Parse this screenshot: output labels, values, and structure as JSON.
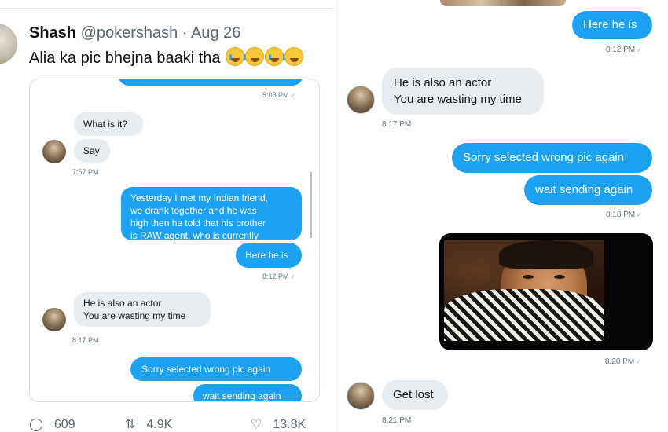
{
  "tweet": {
    "name": "Shash",
    "handle": "@pokershash",
    "dot": "·",
    "date": "Aug 26",
    "text": "Alia ka pic bhejna baaki tha",
    "emojis": [
      "loudly-crying-face",
      "grinning-squinting-face",
      "loudly-crying-face",
      "grinning-squinting-face"
    ],
    "actions": {
      "replies": "609",
      "retweets": "4.9K",
      "likes": "13.8K"
    }
  },
  "embedded_chat": {
    "messages": [
      {
        "side": "out",
        "time": "5:03 PM"
      },
      {
        "side": "in",
        "text": "What is it?"
      },
      {
        "side": "in",
        "text": "Say",
        "time": "7:57 PM"
      },
      {
        "side": "out",
        "lines": [
          "Yesterday I met my Indian friend,",
          "we drank together and he was",
          "high then he told that his brother",
          "is RAW agent, who is currently"
        ]
      },
      {
        "side": "out",
        "text": "Here he is",
        "time": "8:12 PM"
      },
      {
        "side": "in",
        "lines": [
          "He is also an actor",
          "You are wasting my time"
        ],
        "time": "8:17 PM"
      },
      {
        "side": "out",
        "text": "Sorry selected wrong pic again"
      },
      {
        "side": "out",
        "text": "wait sending again"
      }
    ]
  },
  "dm_panel": {
    "messages": [
      {
        "side": "out",
        "text": "Here he is",
        "time": "8:12 PM"
      },
      {
        "side": "in",
        "lines": [
          "He is also an actor",
          "You are wasting my time"
        ],
        "time": "8:17 PM"
      },
      {
        "side": "out",
        "text": "Sorry selected wrong pic again"
      },
      {
        "side": "out",
        "text": "wait sending again",
        "time": "8:18 PM"
      },
      {
        "side": "out",
        "type": "image",
        "time": "8:20 PM"
      },
      {
        "side": "in",
        "text": "Get lost",
        "time": "8:21 PM"
      }
    ],
    "read_tick": "✓"
  },
  "colors": {
    "outgoing_bubble": "#1da1f2",
    "incoming_bubble": "#e6ecf0",
    "muted_text": "#657786"
  }
}
